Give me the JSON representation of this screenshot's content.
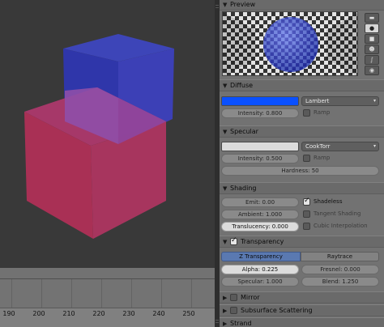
{
  "timeline": {
    "ticks": [
      "190",
      "200",
      "210",
      "220",
      "230",
      "240",
      "250"
    ]
  },
  "preview": {
    "title": "Preview",
    "tabs": [
      "flat-icon",
      "sphere-icon",
      "cube-icon",
      "monkey-icon",
      "hair-icon",
      "world-sphere-icon"
    ],
    "active_tab": 1
  },
  "diffuse": {
    "title": "Diffuse",
    "color": "#0a50ff",
    "shader": "Lambert",
    "intensity": "Intensity: 0.800",
    "ramp": "Ramp"
  },
  "specular": {
    "title": "Specular",
    "color": "#dcdcdc",
    "shader": "CookTorr",
    "intensity": "Intensity: 0.500",
    "ramp": "Ramp",
    "hardness": "Hardness: 50"
  },
  "shading": {
    "title": "Shading",
    "emit": "Emit: 0.00",
    "ambient": "Ambient: 1.000",
    "translucency": "Translucency: 0.000",
    "shadeless": "Shadeless",
    "tangent": "Tangent Shading",
    "cubic": "Cubic Interpolation"
  },
  "transparency": {
    "title": "Transparency",
    "modes": [
      "Z Transparency",
      "Raytrace"
    ],
    "alpha": "Alpha: 0.225",
    "fresnel": "Fresnel: 0.000",
    "specular": "Specular: 1.000",
    "blend": "Blend: 1.250"
  },
  "mirror": {
    "title": "Mirror"
  },
  "sss": {
    "title": "Subsurface Scattering"
  },
  "strand": {
    "title": "Strand"
  }
}
